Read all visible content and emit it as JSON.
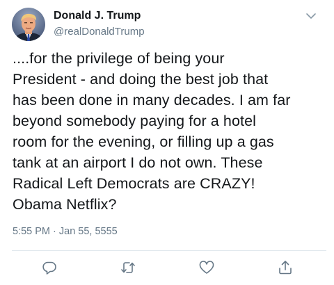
{
  "tweet": {
    "author": {
      "display_name": "Donald J. Trump",
      "handle": "@realDonaldTrump",
      "avatar": "profile-photo"
    },
    "text": "....for the privilege of being your\nPresident - and doing the best job that\nhas been done in many decades. I am far\nbeyond somebody paying for a hotel\nroom for the evening, or filling up a gas\ntank at an airport I do not own. These\nRadical Left Democrats are CRAZY!\nObama Netflix?",
    "timestamp": "5:55 PM · Jan 55, 5555",
    "menu_icon": "chevron-down-icon",
    "actions": {
      "reply_icon": "reply-icon",
      "retweet_icon": "retweet-icon",
      "like_icon": "heart-icon",
      "share_icon": "share-icon"
    }
  },
  "colors": {
    "text": "#14171a",
    "secondary": "#657786",
    "divider": "#e1e8ed"
  }
}
